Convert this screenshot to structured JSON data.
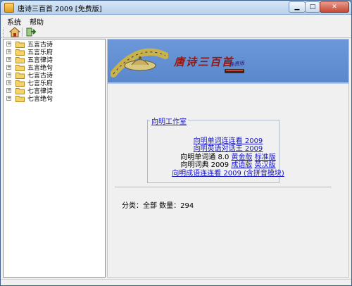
{
  "window": {
    "title": "唐诗三百首 2009 [免费版]"
  },
  "menubar": {
    "items": [
      {
        "label": "系统"
      },
      {
        "label": "帮助"
      }
    ]
  },
  "toolbar": {
    "home_icon": "home-icon",
    "exit_icon": "exit-icon"
  },
  "tree": {
    "items": [
      {
        "label": "五言古诗"
      },
      {
        "label": "五言乐府"
      },
      {
        "label": "五言律诗"
      },
      {
        "label": "五言绝句"
      },
      {
        "label": "七言古诗"
      },
      {
        "label": "七言乐府"
      },
      {
        "label": "七言律诗"
      },
      {
        "label": "七言绝句"
      }
    ]
  },
  "banner": {
    "title": "唐诗三百首",
    "tag": "免费版"
  },
  "studio": {
    "title": "向明工作室",
    "line1": "向明单词连连看 2009",
    "line2": "向明英语对话王 2009",
    "line3_prefix": "向明单词通 8.0",
    "line3_link1": "黄金版",
    "line3_link2": "标准版",
    "line4_prefix": "向明词典 2009",
    "line4_link1": "成语版",
    "line4_link2": "英汉版",
    "line5": "向明成语连连看 2009 (含拼音模块)"
  },
  "status": {
    "text": "分类：全部 数量：294"
  },
  "colors": {
    "accent": "#1515c8",
    "banner_bg": "#6a98d8",
    "banner_title": "#8b1a1a"
  }
}
